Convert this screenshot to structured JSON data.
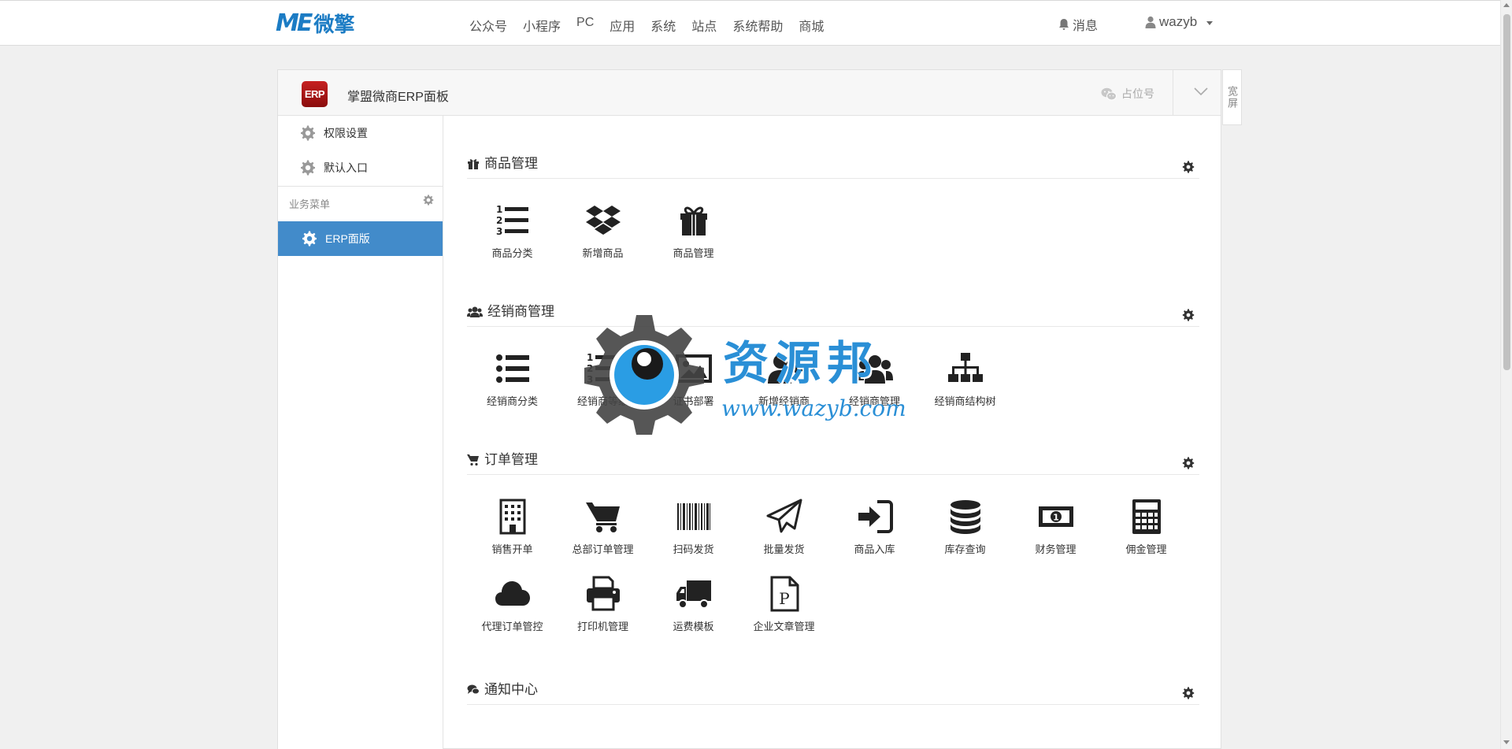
{
  "topbar": {
    "logo_mark": "ME",
    "logo_text": "微擎",
    "nav": [
      "公众号",
      "小程序",
      "PC",
      "应用",
      "系统",
      "站点",
      "系统帮助",
      "商城"
    ],
    "messages_label": "消息",
    "username": "wazyb"
  },
  "panel": {
    "badge": "ERP",
    "title": "掌盟微商ERP面板",
    "placeholder_label": "占位号",
    "wide_label": "宽屏"
  },
  "sidebar": {
    "items": [
      {
        "label": "权限设置",
        "icon": "gear-icon"
      },
      {
        "label": "默认入口",
        "icon": "gear-icon"
      }
    ],
    "section_label": "业务菜单",
    "active_item": {
      "label": "ERP面版",
      "icon": "gear-icon"
    }
  },
  "sections": [
    {
      "title": "商品管理",
      "icon": "gift-icon",
      "tiles": [
        {
          "label": "商品分类",
          "icon": "ordered-list-icon"
        },
        {
          "label": "新增商品",
          "icon": "dropbox-icon"
        },
        {
          "label": "商品管理",
          "icon": "gift-icon"
        }
      ]
    },
    {
      "title": "经销商管理",
      "icon": "users-icon",
      "tiles": [
        {
          "label": "经销商分类",
          "icon": "list-icon"
        },
        {
          "label": "经销商等级",
          "icon": "ordered-list-icon"
        },
        {
          "label": "证书部署",
          "icon": "image-icon"
        },
        {
          "label": "新增经销商",
          "icon": "user-plus-icon"
        },
        {
          "label": "经销商管理",
          "icon": "users-icon"
        },
        {
          "label": "经销商结构树",
          "icon": "sitemap-icon"
        }
      ]
    },
    {
      "title": "订单管理",
      "icon": "cart-icon",
      "tiles": [
        {
          "label": "销售开单",
          "icon": "building-icon"
        },
        {
          "label": "总部订单管理",
          "icon": "cart-icon"
        },
        {
          "label": "扫码发货",
          "icon": "barcode-icon"
        },
        {
          "label": "批量发货",
          "icon": "paper-plane-icon"
        },
        {
          "label": "商品入库",
          "icon": "sign-in-icon"
        },
        {
          "label": "库存查询",
          "icon": "database-icon"
        },
        {
          "label": "财务管理",
          "icon": "money-icon"
        },
        {
          "label": "佣金管理",
          "icon": "calculator-icon"
        },
        {
          "label": "代理订单管控",
          "icon": "cloud-icon"
        },
        {
          "label": "打印机管理",
          "icon": "print-icon"
        },
        {
          "label": "运费模板",
          "icon": "truck-icon"
        },
        {
          "label": "企业文章管理",
          "icon": "file-p-icon"
        }
      ]
    },
    {
      "title": "通知中心",
      "icon": "comments-icon",
      "tiles": []
    }
  ],
  "watermark": {
    "title": "资源邦",
    "url": "www.wazyb.com"
  },
  "colors": {
    "brand": "#1c7cc4",
    "active": "#428bca",
    "erp_badge": "#b31717"
  }
}
